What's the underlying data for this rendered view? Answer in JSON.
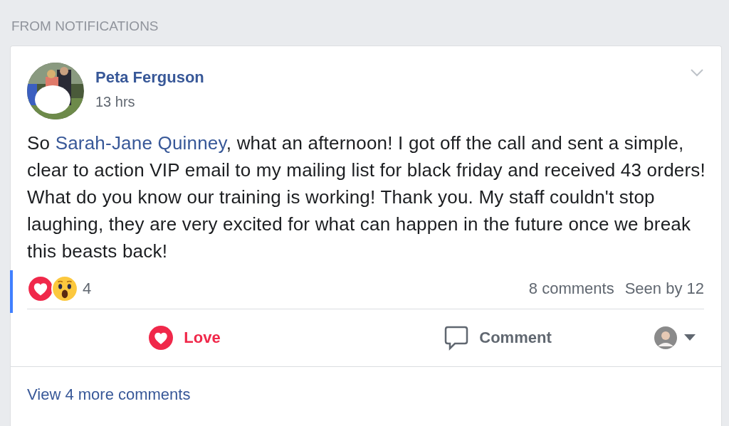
{
  "section_title": "FROM NOTIFICATIONS",
  "post": {
    "author": "Peta Ferguson",
    "time": "13 hrs",
    "mention": "Sarah-Jane Quinney",
    "text_before": "So ",
    "text_after": ", what an afternoon! I got off the call and sent a simple, clear to action VIP email to my mailing list for black friday and received 43 orders! What do you know our training is working! Thank you. My staff couldn't stop laughing, they are very excited for what can happen in the future once we break this beasts back!",
    "reaction_count": "4",
    "comments": "8 comments",
    "seen_by": "Seen by 12",
    "unread": true
  },
  "actions": [
    {
      "kind": "love",
      "label": "Love",
      "selected": true
    },
    {
      "kind": "comment",
      "label": "Comment",
      "selected": false
    }
  ],
  "view_more": "View 4 more comments"
}
